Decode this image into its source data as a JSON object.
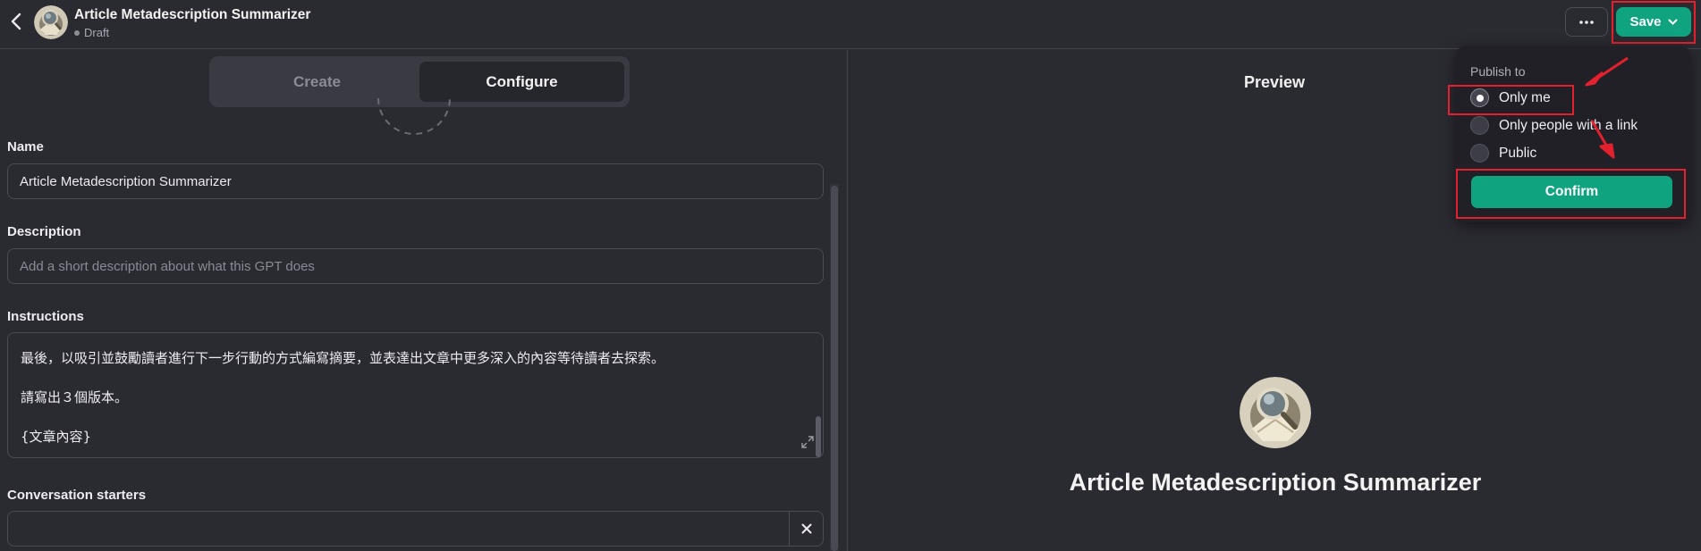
{
  "header": {
    "title": "Article Metadescription Summarizer",
    "status": "Draft",
    "save_label": "Save",
    "more_icon": "more-horizontal-icon"
  },
  "tabs": [
    {
      "label": "Create",
      "active": false
    },
    {
      "label": "Configure",
      "active": true
    }
  ],
  "form": {
    "name_label": "Name",
    "name_value": "Article Metadescription Summarizer",
    "description_label": "Description",
    "description_placeholder": "Add a short description about what this GPT does",
    "instructions_label": "Instructions",
    "instructions_lines": [
      "最後，以吸引並鼓勵讀者進行下一步行動的方式編寫摘要，並表達出文章中更多深入的內容等待讀者去探索。",
      "請寫出３個版本。",
      "{文章內容}"
    ],
    "starters_label": "Conversation starters"
  },
  "preview": {
    "title": "Preview",
    "gpt_name": "Article Metadescription Summarizer"
  },
  "publish_menu": {
    "heading": "Publish to",
    "options": [
      {
        "label": "Only me",
        "checked": true
      },
      {
        "label": "Only people with a link",
        "checked": false
      },
      {
        "label": "Public",
        "checked": false
      }
    ],
    "confirm_label": "Confirm"
  },
  "colors": {
    "accent": "#10a37f",
    "annotation": "#e3202d",
    "background": "#2a2a31"
  }
}
